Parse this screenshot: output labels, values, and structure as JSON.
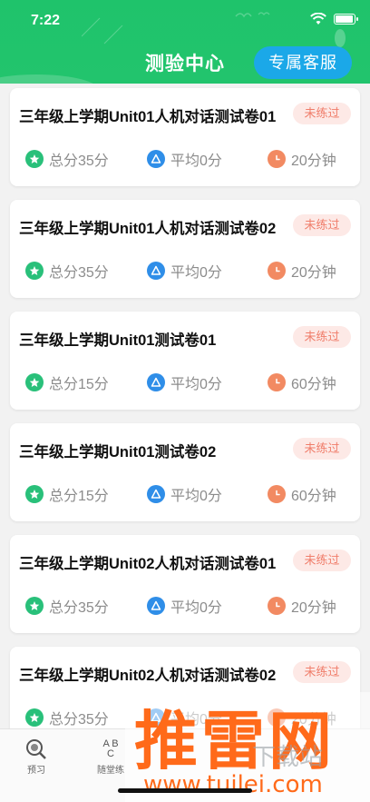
{
  "status_bar": {
    "time": "7:22"
  },
  "header": {
    "title": "测验中心",
    "service_button": "专属客服"
  },
  "tests": [
    {
      "title": "三年级上学期Unit01人机对话测试卷01",
      "status": "未练过",
      "score": "总分35分",
      "average": "平均0分",
      "duration": "20分钟"
    },
    {
      "title": "三年级上学期Unit01人机对话测试卷02",
      "status": "未练过",
      "score": "总分35分",
      "average": "平均0分",
      "duration": "20分钟"
    },
    {
      "title": "三年级上学期Unit01测试卷01",
      "status": "未练过",
      "score": "总分15分",
      "average": "平均0分",
      "duration": "60分钟"
    },
    {
      "title": "三年级上学期Unit01测试卷02",
      "status": "未练过",
      "score": "总分15分",
      "average": "平均0分",
      "duration": "60分钟"
    },
    {
      "title": "三年级上学期Unit02人机对话测试卷01",
      "status": "未练过",
      "score": "总分35分",
      "average": "平均0分",
      "duration": "20分钟"
    },
    {
      "title": "三年级上学期Unit02人机对话测试卷02",
      "status": "未练过",
      "score": "总分35分",
      "average": "平均0分",
      "duration": "20分钟"
    }
  ],
  "tabbar": {
    "tabs": [
      {
        "label": "预习",
        "icon": "magnifier-icon"
      },
      {
        "label": "随堂练",
        "icon": "abc-icon",
        "icon_text": "A B C"
      }
    ]
  },
  "watermark": {
    "text": "推雷网",
    "url": "www.tuilei.com",
    "overlay": "下载站"
  },
  "colors": {
    "header": "#22c46d",
    "service_button": "#1ba8e8",
    "badge_text": "#f07d6a",
    "badge_bg": "#fde9e6",
    "score_icon": "#29c07a",
    "average_icon": "#2f8ee8",
    "time_icon": "#f28a62",
    "watermark": "#ff6a1a"
  },
  "icons": {
    "score": "star-icon",
    "average": "triangle-icon",
    "duration": "clock-icon"
  }
}
